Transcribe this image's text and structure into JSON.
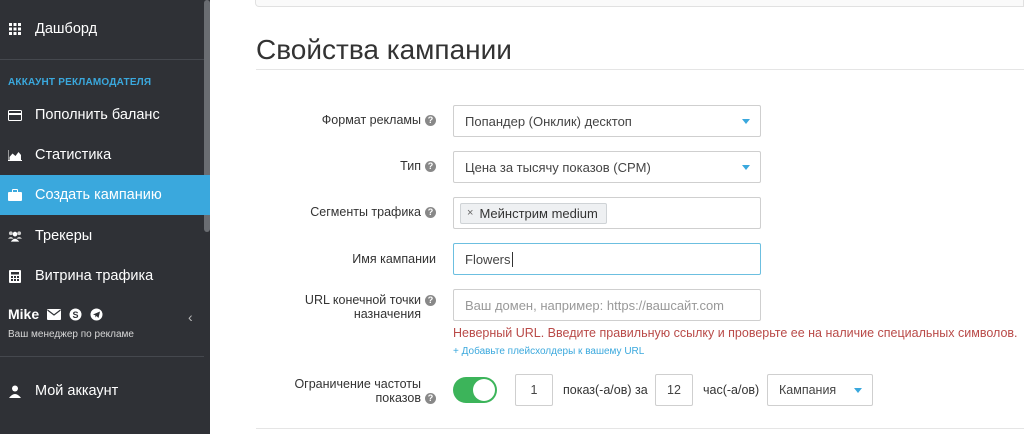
{
  "sidebar": {
    "dashboard": "Дашборд",
    "section_title": "АККАУНТ РЕКЛАМОДАТЕЛЯ",
    "items": [
      {
        "label": "Пополнить баланс",
        "icon": "credit-card-icon"
      },
      {
        "label": "Статистика",
        "icon": "chart-icon"
      },
      {
        "label": "Создать кампанию",
        "icon": "briefcase-icon",
        "active": true
      },
      {
        "label": "Трекеры",
        "icon": "users-icon"
      },
      {
        "label": "Витрина трафика",
        "icon": "calculator-icon"
      }
    ],
    "manager": {
      "name": "Mike",
      "subtitle": "Ваш менеджер по рекламе"
    },
    "account": "Мой аккаунт",
    "accent": "#3aa8dd"
  },
  "main": {
    "title": "Свойства кампании",
    "form": {
      "ad_format": {
        "label": "Формат рекламы",
        "value": "Попандер (Онклик) десктоп"
      },
      "type": {
        "label": "Тип",
        "value": "Цена за тысячу показов (CPM)"
      },
      "segments": {
        "label": "Сегменты трафика",
        "tag": "Мейнстрим medium"
      },
      "campaign_name": {
        "label": "Имя кампании",
        "value": "Flowers"
      },
      "url": {
        "label_line1": "URL конечной точки",
        "label_line2": "назначения",
        "placeholder": "Ваш домен, например: https://вашсайт.com",
        "error": "Неверный URL. Введите правильную ссылку и проверьте ее на наличие специальных символов.",
        "hint": "+ Добавьте плейсхолдеры к вашему URL"
      },
      "frequency": {
        "label_line1": "Ограничение частоты",
        "label_line2": "показов",
        "enabled": true,
        "impressions": "1",
        "impressions_label": "показ(-а/ов) за",
        "hours": "12",
        "hours_label": "час(-а/ов)",
        "scope": "Кампания"
      }
    }
  }
}
